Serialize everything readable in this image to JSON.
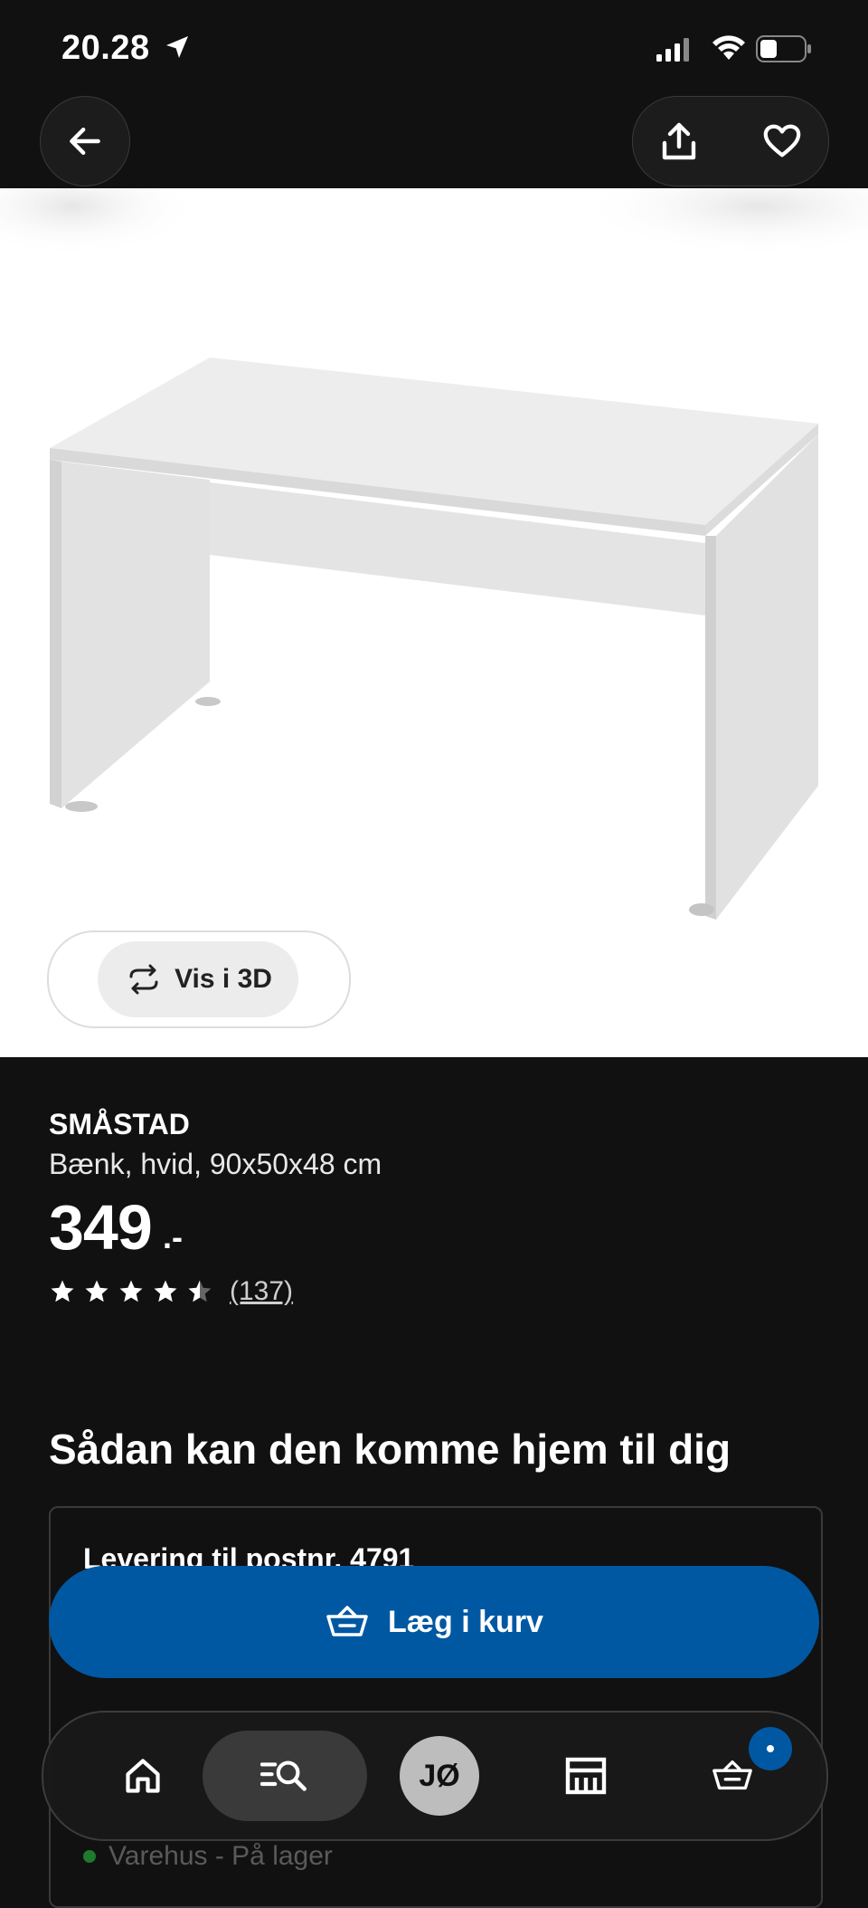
{
  "status_bar": {
    "time": "20.28"
  },
  "product": {
    "view_3d_label": "Vis i 3D",
    "brand": "SMÅSTAD",
    "description": "Bænk, hvid, 90x50x48 cm",
    "price": "349",
    "price_suffix": ".-",
    "rating_value": 4.5,
    "rating_max": 5,
    "review_count": "(137)"
  },
  "delivery": {
    "section_title": "Sådan kan den komme hjem til dig",
    "delivery_title": "Levering til postnr. 4791",
    "store_stock": "Varehus - På lager"
  },
  "actions": {
    "add_to_cart": "Læg i kurv"
  },
  "bottom_nav": {
    "profile_initials": "JØ"
  },
  "colors": {
    "accent": "#0058a3",
    "background": "#111111",
    "stock_green": "#1e7a2e"
  },
  "icons": [
    "back-arrow-icon",
    "share-icon",
    "heart-icon",
    "rotate-3d-icon",
    "star-icon",
    "basket-icon",
    "home-icon",
    "search-icon",
    "store-icon"
  ]
}
